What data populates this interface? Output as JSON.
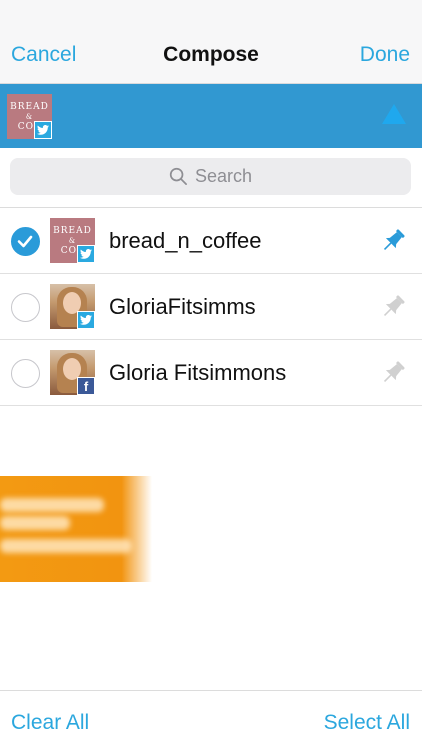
{
  "nav": {
    "cancel": "Cancel",
    "title": "Compose",
    "done": "Done"
  },
  "selected_bar": {
    "avatar": {
      "name": "bread_n_coffee",
      "network": "twitter-badge-icon"
    },
    "arrow_icon": "collapse-arrow-icon"
  },
  "search": {
    "placeholder": "Search",
    "icon": "search-icon"
  },
  "accounts": [
    {
      "name": "bread_n_coffee",
      "selected": true,
      "network": "twitter",
      "pinned": true
    },
    {
      "name": "GloriaFitsimms",
      "selected": false,
      "network": "twitter",
      "pinned": false
    },
    {
      "name": "Gloria Fitsimmons",
      "selected": false,
      "network": "facebook",
      "pinned": false
    }
  ],
  "footer": {
    "clear_all": "Clear All",
    "select_all": "Select All"
  },
  "colors": {
    "accent": "#2ba7de",
    "selected_bar": "#3198d1",
    "pin_active": "#2a9bd9",
    "pin_inactive": "#d0d0d0",
    "promo": "#f39a12"
  }
}
